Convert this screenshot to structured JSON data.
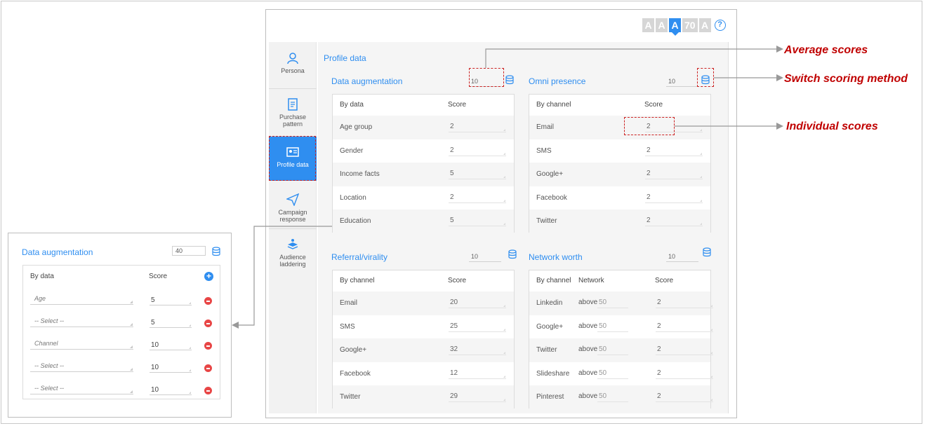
{
  "font_controls": {
    "buttons": [
      "A",
      "A",
      "A",
      "70",
      "A"
    ],
    "active_index": 2,
    "help": "?"
  },
  "sidebar": {
    "items": [
      {
        "label": "Persona",
        "icon": "persona-icon"
      },
      {
        "label": "Purchase pattern",
        "icon": "purchase-pattern-icon"
      },
      {
        "label": "Profile data",
        "icon": "profile-card-icon",
        "active": true
      },
      {
        "label": "Campaign response",
        "icon": "paper-plane-icon"
      },
      {
        "label": "Audience laddering",
        "icon": "audience-laddering-icon"
      }
    ]
  },
  "page_title": "Profile data",
  "sections": {
    "data_augmentation": {
      "title": "Data augmentation",
      "average": "10",
      "headers": [
        "By data",
        "Score"
      ],
      "rows": [
        {
          "label": "Age group",
          "score": "2"
        },
        {
          "label": "Gender",
          "score": "2"
        },
        {
          "label": "Income facts",
          "score": "5"
        },
        {
          "label": "Location",
          "score": "2"
        },
        {
          "label": "Education",
          "score": "5"
        }
      ]
    },
    "omni_presence": {
      "title": "Omni presence",
      "average": "10",
      "headers": [
        "By channel",
        "Score"
      ],
      "rows": [
        {
          "label": "Email",
          "score": "2"
        },
        {
          "label": "SMS",
          "score": "2"
        },
        {
          "label": "Google+",
          "score": "2"
        },
        {
          "label": "Facebook",
          "score": "2"
        },
        {
          "label": "Twitter",
          "score": "2"
        }
      ]
    },
    "referral_virality": {
      "title": "Referral/virality",
      "average": "10",
      "headers": [
        "By channel",
        "Score"
      ],
      "rows": [
        {
          "label": "Email",
          "score": "20"
        },
        {
          "label": "SMS",
          "score": "25"
        },
        {
          "label": "Google+",
          "score": "32"
        },
        {
          "label": "Facebook",
          "score": "12"
        },
        {
          "label": "Twitter",
          "score": "29"
        }
      ]
    },
    "network_worth": {
      "title": "Network worth",
      "average": "10",
      "headers": [
        "By channel",
        "Network",
        "Score"
      ],
      "rows": [
        {
          "label": "Linkedin",
          "qualifier": "above",
          "network": "50",
          "score": "2"
        },
        {
          "label": "Google+",
          "qualifier": "above",
          "network": "50",
          "score": "2"
        },
        {
          "label": "Twitter",
          "qualifier": "above",
          "network": "50",
          "score": "2"
        },
        {
          "label": "Slideshare",
          "qualifier": "above",
          "network": "50",
          "score": "2"
        },
        {
          "label": "Pinterest",
          "qualifier": "above",
          "network": "50",
          "score": "2"
        }
      ]
    }
  },
  "zoom_panel": {
    "title": "Data augmentation",
    "average": "40",
    "headers": [
      "By data",
      "Score"
    ],
    "rows": [
      {
        "select": "Age",
        "score": "5"
      },
      {
        "select": "-- Select --",
        "score": "5"
      },
      {
        "select": "Channel",
        "score": "10"
      },
      {
        "select": "-- Select --",
        "score": "10"
      },
      {
        "select": "-- Select --",
        "score": "10"
      }
    ]
  },
  "annotations": {
    "average_scores": "Average scores",
    "switch_scoring": "Switch scoring method",
    "individual_scores": "Individual scores"
  },
  "colors": {
    "accent": "#2f8ef0",
    "annotation": "#c00000",
    "remove": "#e84646"
  }
}
